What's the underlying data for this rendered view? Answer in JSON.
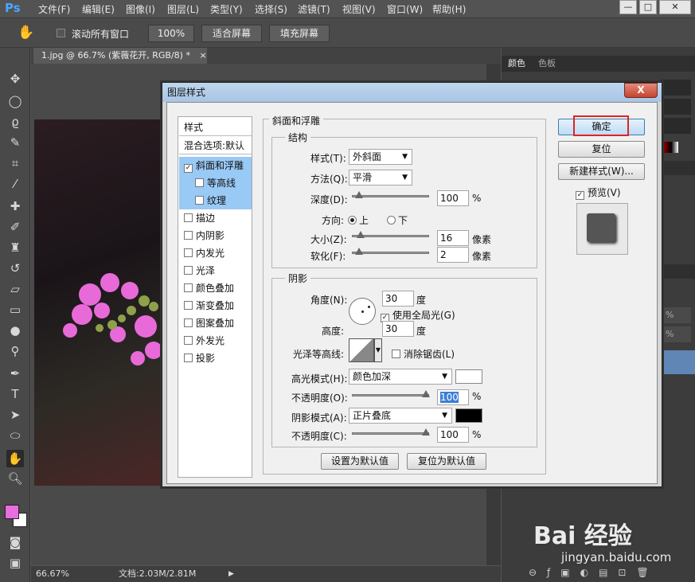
{
  "menubar": {
    "logo": "Ps",
    "items": [
      "文件(F)",
      "编辑(E)",
      "图像(I)",
      "图层(L)",
      "类型(Y)",
      "选择(S)",
      "滤镜(T)",
      "视图(V)",
      "窗口(W)",
      "帮助(H)"
    ]
  },
  "optionsbar": {
    "scroll_all": "滚动所有窗口",
    "zoom100": "100%",
    "fit_screen": "适合屏幕",
    "fill_screen": "填充屏幕"
  },
  "document": {
    "tab_title": "1.jpg @ 66.7% (紫薇花开, RGB/8) *",
    "zoom": "66.67%",
    "docsize": "文档:2.03M/2.81M"
  },
  "panels": {
    "tab1": "颜色",
    "tab2": "色板",
    "pct1": "%",
    "pct2": "%"
  },
  "colors": {
    "foreground": "#e86ee0",
    "background": "#ffffff",
    "highlight_color": "#ffffff",
    "shadow_color": "#000000"
  },
  "dialog": {
    "title": "图层样式",
    "close": "X",
    "styles_header": "样式",
    "blend_options": "混合选项:默认",
    "items": [
      "斜面和浮雕",
      "等高线",
      "纹理",
      "描边",
      "内阴影",
      "内发光",
      "光泽",
      "颜色叠加",
      "渐变叠加",
      "图案叠加",
      "外发光",
      "投影"
    ],
    "section_title": "斜面和浮雕",
    "structure": {
      "title": "结构",
      "style_label": "样式(T):",
      "style_value": "外斜面",
      "technique_label": "方法(Q):",
      "technique_value": "平滑",
      "depth_label": "深度(D):",
      "depth_value": "100",
      "depth_unit": "%",
      "direction_label": "方向:",
      "dir_up": "上",
      "dir_down": "下",
      "size_label": "大小(Z):",
      "size_value": "16",
      "size_unit": "像素",
      "soften_label": "软化(F):",
      "soften_value": "2",
      "soften_unit": "像素"
    },
    "shading": {
      "title": "阴影",
      "angle_label": "角度(N):",
      "angle_value": "30",
      "angle_unit": "度",
      "global_light": "使用全局光(G)",
      "altitude_label": "高度:",
      "altitude_value": "30",
      "altitude_unit": "度",
      "gloss_label": "光泽等高线:",
      "antialias": "消除锯齿(L)",
      "highlight_mode_label": "高光模式(H):",
      "highlight_mode_value": "颜色加深",
      "opacity1_label": "不透明度(O):",
      "opacity1_value": "100",
      "opacity1_unit": "%",
      "shadow_mode_label": "阴影模式(A):",
      "shadow_mode_value": "正片叠底",
      "opacity2_label": "不透明度(C):",
      "opacity2_value": "100",
      "opacity2_unit": "%"
    },
    "make_default": "设置为默认值",
    "reset_default": "复位为默认值",
    "ok": "确定",
    "reset": "复位",
    "new_style": "新建样式(W)...",
    "preview": "预览(V)"
  },
  "watermark": {
    "text": "Bai 经验",
    "url": "jingyan.baidu.com"
  }
}
